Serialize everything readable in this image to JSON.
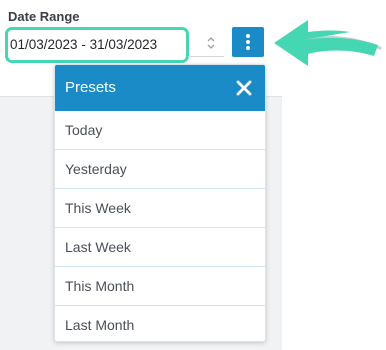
{
  "date_range": {
    "label": "Date Range",
    "value": "01/03/2023 - 31/03/2023"
  },
  "presets": {
    "title": "Presets",
    "items": [
      "Today",
      "Yesterday",
      "This Week",
      "Last Week",
      "This Month",
      "Last Month"
    ]
  },
  "colors": {
    "accent": "#1a8bc6",
    "highlight": "#45d6b2"
  },
  "icons": {
    "stepper": "up-down-chevron-icon",
    "menu": "vertical-ellipsis-icon",
    "close": "close-icon",
    "pointer": "curved-arrow-icon"
  }
}
